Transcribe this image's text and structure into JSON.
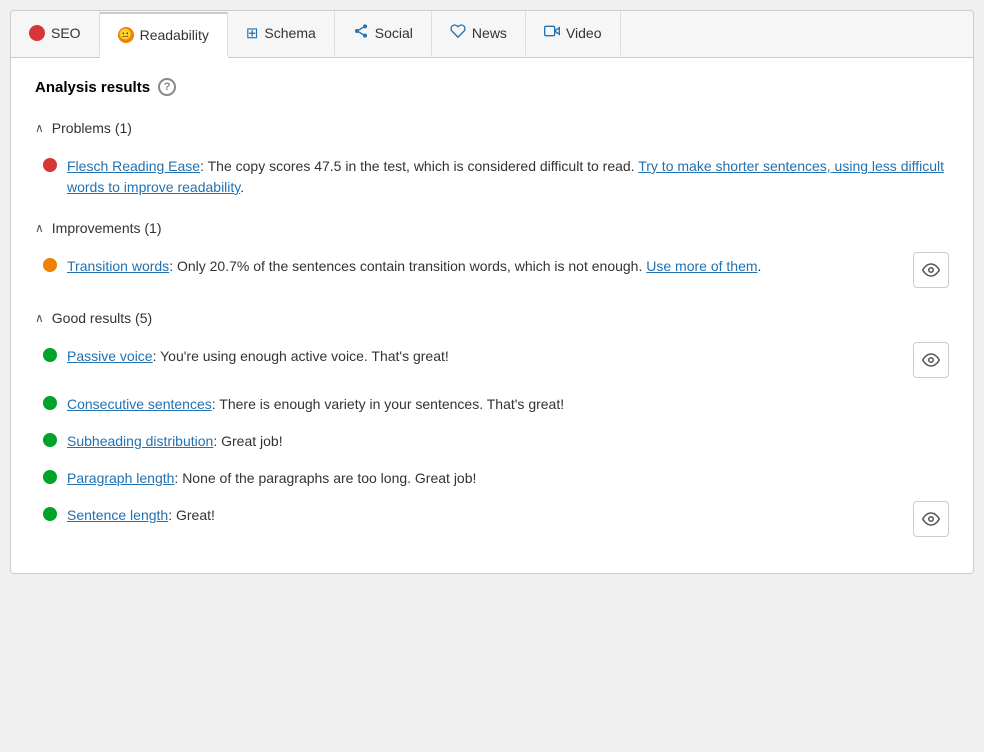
{
  "tabs": [
    {
      "id": "seo",
      "label": "SEO",
      "icon_type": "dot-red",
      "active": false
    },
    {
      "id": "readability",
      "label": "Readability",
      "icon_type": "dot-orange",
      "active": true
    },
    {
      "id": "schema",
      "label": "Schema",
      "icon_type": "grid",
      "active": false
    },
    {
      "id": "social",
      "label": "Social",
      "icon_type": "share",
      "active": false
    },
    {
      "id": "news",
      "label": "News",
      "icon_type": "news",
      "active": false
    },
    {
      "id": "video",
      "label": "Video",
      "icon_type": "video",
      "active": false
    }
  ],
  "analysis": {
    "title": "Analysis results",
    "help_label": "?",
    "sections": [
      {
        "id": "problems",
        "label": "Problems (1)",
        "expanded": true,
        "items": [
          {
            "id": "flesch",
            "dot": "red",
            "text_parts": [
              {
                "type": "link",
                "text": "Flesch Reading Ease"
              },
              {
                "type": "plain",
                "text": ": The copy scores 47.5 in the test, which is considered difficult to read. "
              },
              {
                "type": "link",
                "text": "Try to make shorter sentences, using less difficult words to improve readability"
              },
              {
                "type": "plain",
                "text": "."
              }
            ],
            "has_eye": false
          }
        ]
      },
      {
        "id": "improvements",
        "label": "Improvements (1)",
        "expanded": true,
        "items": [
          {
            "id": "transition",
            "dot": "orange",
            "text_parts": [
              {
                "type": "link",
                "text": "Transition words"
              },
              {
                "type": "plain",
                "text": ": Only 20.7% of the sentences contain transition words, which is not enough. "
              },
              {
                "type": "link",
                "text": "Use more of them"
              },
              {
                "type": "plain",
                "text": "."
              }
            ],
            "has_eye": true
          }
        ]
      },
      {
        "id": "good",
        "label": "Good results (5)",
        "expanded": true,
        "items": [
          {
            "id": "passive",
            "dot": "green",
            "text_parts": [
              {
                "type": "link",
                "text": "Passive voice"
              },
              {
                "type": "plain",
                "text": ": You're using enough active voice. That's great!"
              }
            ],
            "has_eye": true
          },
          {
            "id": "consecutive",
            "dot": "green",
            "text_parts": [
              {
                "type": "link",
                "text": "Consecutive sentences"
              },
              {
                "type": "plain",
                "text": ": There is enough variety in your sentences. That's great!"
              }
            ],
            "has_eye": false
          },
          {
            "id": "subheading",
            "dot": "green",
            "text_parts": [
              {
                "type": "link",
                "text": "Subheading distribution"
              },
              {
                "type": "plain",
                "text": ": Great job!"
              }
            ],
            "has_eye": false
          },
          {
            "id": "paragraph",
            "dot": "green",
            "text_parts": [
              {
                "type": "link",
                "text": "Paragraph length"
              },
              {
                "type": "plain",
                "text": ": None of the paragraphs are too long. Great job!"
              }
            ],
            "has_eye": false
          },
          {
            "id": "sentence",
            "dot": "green",
            "text_parts": [
              {
                "type": "link",
                "text": "Sentence length"
              },
              {
                "type": "plain",
                "text": ": Great!"
              }
            ],
            "has_eye": true
          }
        ]
      }
    ]
  }
}
